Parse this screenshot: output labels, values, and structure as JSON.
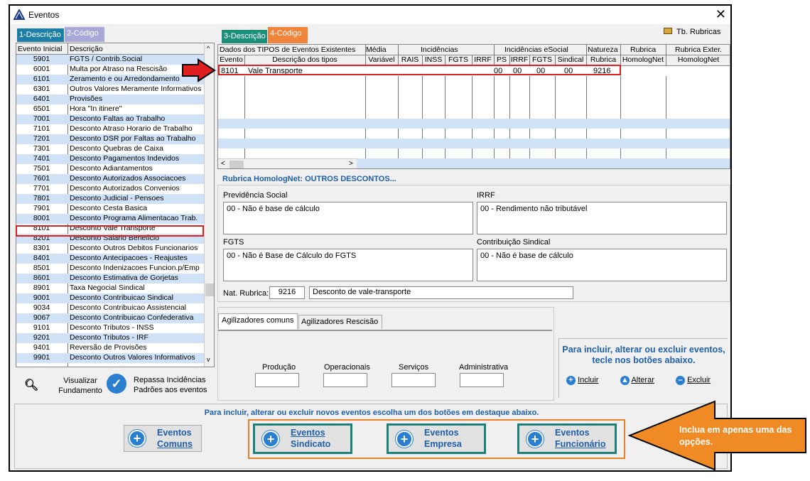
{
  "window": {
    "title": "Eventos",
    "tb_rubricas": "Tb. Rubricas"
  },
  "left_tabs": [
    {
      "label": "1-Descrição"
    },
    {
      "label": "2-Código"
    }
  ],
  "right_tabs": [
    {
      "label": "3-Descrição"
    },
    {
      "label": "4-Código"
    }
  ],
  "left_grid": {
    "headers": [
      "Evento Inicial",
      "Descrição"
    ],
    "rows": [
      {
        "code": "5901",
        "desc": "FGTS / Contrib.Social",
        "hl": true
      },
      {
        "code": "6001",
        "desc": "Multa por Atraso na Rescisão",
        "hl": false
      },
      {
        "code": "6101",
        "desc": "Zeramento e ou Arredondamento",
        "hl": true
      },
      {
        "code": "6301",
        "desc": "Outros Valores Meramente Informativos",
        "hl": false
      },
      {
        "code": "6401",
        "desc": "Provisões",
        "hl": true
      },
      {
        "code": "6501",
        "desc": "Hora \"In itinere\"",
        "hl": false
      },
      {
        "code": "7001",
        "desc": "Desconto Faltas ao Trabalho",
        "hl": true
      },
      {
        "code": "7101",
        "desc": "Desconto Atraso Horario de Trabalho",
        "hl": false
      },
      {
        "code": "7201",
        "desc": "Desconto DSR por Faltas ao Trabalho",
        "hl": true
      },
      {
        "code": "7301",
        "desc": "Desconto Quebras de Caixa",
        "hl": false
      },
      {
        "code": "7401",
        "desc": "Desconto Pagamentos Indevidos",
        "hl": true
      },
      {
        "code": "7501",
        "desc": "Desconto Adiantamentos",
        "hl": false
      },
      {
        "code": "7601",
        "desc": "Desconto Autorizados Associacoes",
        "hl": true
      },
      {
        "code": "7701",
        "desc": "Desconto Autorizados Convenios",
        "hl": false
      },
      {
        "code": "7801",
        "desc": "Desconto Judicial - Pensoes",
        "hl": true
      },
      {
        "code": "7901",
        "desc": "Desconto Cesta Basica",
        "hl": false
      },
      {
        "code": "8001",
        "desc": "Desconto Programa Alimentacao Trab.",
        "hl": true
      },
      {
        "code": "8101",
        "desc": "Desconto Vale Transporte",
        "hl": false
      },
      {
        "code": "8201",
        "desc": "Desconto Salario Beneficio",
        "hl": true
      },
      {
        "code": "8301",
        "desc": "Desconto Outros Debitos Funcionarios",
        "hl": false
      },
      {
        "code": "8401",
        "desc": "Desconto Antecipacoes - Reajustes",
        "hl": true
      },
      {
        "code": "8501",
        "desc": "Desconto Indenizacoes Funcion.p/Emp",
        "hl": false
      },
      {
        "code": "8601",
        "desc": "Desconto Estimativa de Gorjetas",
        "hl": true
      },
      {
        "code": "8901",
        "desc": "Taxa Negocial Sindical",
        "hl": false
      },
      {
        "code": "9001",
        "desc": "Desconto Contribuicao Sindical",
        "hl": true
      },
      {
        "code": "9034",
        "desc": "Desconto Contribuicao Assistencial",
        "hl": false
      },
      {
        "code": "9067",
        "desc": "Desconto Contribuicao Confederativa",
        "hl": true
      },
      {
        "code": "9101",
        "desc": "Desconto Tributos - INSS",
        "hl": false
      },
      {
        "code": "9201",
        "desc": "Desconto Tributos - IRF",
        "hl": true
      },
      {
        "code": "9401",
        "desc": "Reversão de Provisões",
        "hl": false
      },
      {
        "code": "9901",
        "desc": "Desconto Outros Valores Informativos",
        "hl": true
      }
    ]
  },
  "right_grid": {
    "group_headers": [
      "Dados dos TIPOS de Eventos Existentes",
      "Média",
      "Incidências",
      "Incidências eSocial",
      "Natureza",
      "Rubrica",
      "Rubrica Exter."
    ],
    "col_headers": [
      "Evento",
      "Descrição dos tipos",
      "Variável",
      "RAIS",
      "INSS",
      "FGTS",
      "IRRF",
      "PS",
      "IRRF",
      "FGTS",
      "Sindical",
      "Rubrica",
      "HomologNet",
      "HomologNet"
    ],
    "row": {
      "evento": "8101",
      "desc": "Vale Transporte",
      "ps": "00",
      "irrf": "00",
      "fgts": "00",
      "sindical": "00",
      "rubrica": "9216"
    }
  },
  "rubrica_title": "Rubrica HomologNet: OUTROS DESCONTOS...",
  "fields": {
    "prev_label": "Previdência Social",
    "prev_value": "00 - Não é base de cálculo",
    "irrf_label": "IRRF",
    "irrf_value": "00 - Rendimento não tributável",
    "fgts_label": "FGTS",
    "fgts_value": "00 - Não é Base de Cálculo do FGTS",
    "sind_label": "Contribuição Sindical",
    "sind_value": "00 - Não é base de cálculo",
    "nat_label": "Nat. Rubrica:",
    "nat_code": "9216",
    "nat_desc": "Desconto de vale-transporte"
  },
  "agiliz_tabs": [
    "Agilizadores comuns",
    "Agilizadores Rescisão"
  ],
  "agiliz_labels": [
    "Produção",
    "Operacionais",
    "Serviços",
    "Administrativa"
  ],
  "info_text": "Para incluir, alterar ou excluir eventos, tecle nos botões abaixo.",
  "actions": {
    "incluir": "Incluir",
    "alterar": "Alterar",
    "excluir": "Excluir"
  },
  "visualizar": "Visualizar Fundamento",
  "repassa": "Repassa Incidências Padrões aos eventos",
  "bottom_note": "Para incluir, alterar ou excluir novos eventos escolha um dos botões em destaque abaixo.",
  "buttons": {
    "comuns": [
      "Eventos",
      "Comuns"
    ],
    "sindicato": [
      "Eventos",
      "Sindicato"
    ],
    "empresa": [
      "Eventos",
      "Empresa"
    ],
    "funcionario": [
      "Eventos",
      "Funcionário"
    ]
  },
  "callout": "Inclua em apenas uma das opções."
}
